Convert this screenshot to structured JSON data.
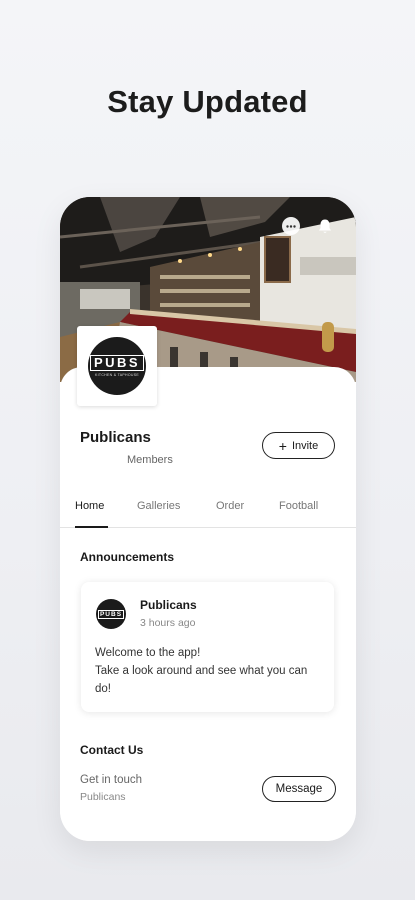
{
  "headline": "Stay Updated",
  "hero": {
    "image": "pub-bar-interior-photo",
    "more_icon": "more-horizontal-icon",
    "bell_icon": "bell-icon"
  },
  "group": {
    "logo_text": "PUBS",
    "logo_subtext": "KITCHEN & TAPHOUSE",
    "name": "Publicans",
    "members_label": "Members",
    "invite_label": "Invite"
  },
  "tabs": [
    {
      "label": "Home",
      "active": true
    },
    {
      "label": "Galleries",
      "active": false
    },
    {
      "label": "Order",
      "active": false
    },
    {
      "label": "Football",
      "active": false
    }
  ],
  "announcements": {
    "title": "Announcements",
    "post": {
      "avatar_text": "PUBS",
      "author": "Publicans",
      "time": "3 hours ago",
      "body": "Welcome to the app!\nTake a look around and see what you can do!"
    }
  },
  "contact": {
    "title": "Contact Us",
    "subtitle": "Get in touch",
    "name": "Publicans",
    "message_label": "Message"
  },
  "colors": {
    "background": "#f1f2f5",
    "card": "#ffffff",
    "text": "#1a1a1a",
    "muted": "#777777"
  }
}
